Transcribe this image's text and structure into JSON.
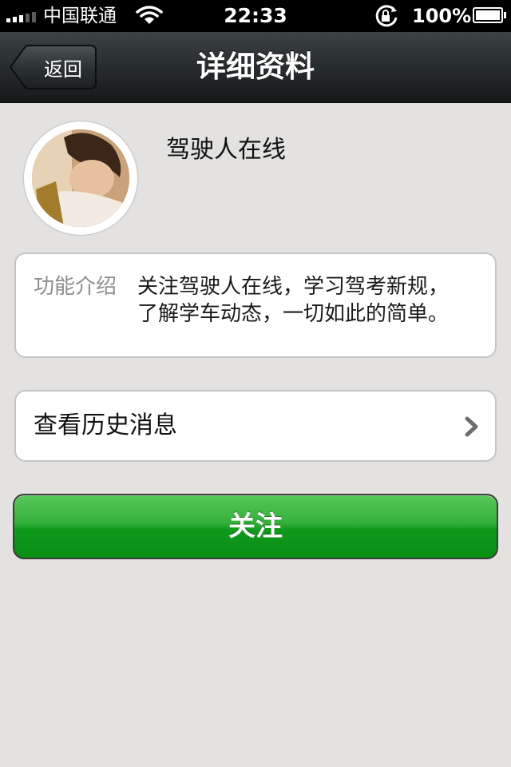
{
  "status_bar": {
    "carrier": "中国联通",
    "time": "22:33",
    "battery_percent": "100%",
    "signal_bars": 3,
    "icons": [
      "signal-icon",
      "wifi-icon",
      "rotation-lock-icon",
      "battery-icon"
    ]
  },
  "nav": {
    "back_label": "返回",
    "title": "详细资料"
  },
  "profile": {
    "name": "驾驶人在线"
  },
  "intro": {
    "label": "功能介绍",
    "text_line1": "关注驾驶人在线，学习驾考新规，",
    "text_line2": "了解学车动态，一切如此的简单。"
  },
  "history": {
    "label": "查看历史消息"
  },
  "follow": {
    "label": "关注"
  },
  "colors": {
    "background": "#e3e2e0",
    "nav_bar": "#272c2e",
    "follow_green": "#1fa52a",
    "secondary_text": "#8d8d8d"
  }
}
